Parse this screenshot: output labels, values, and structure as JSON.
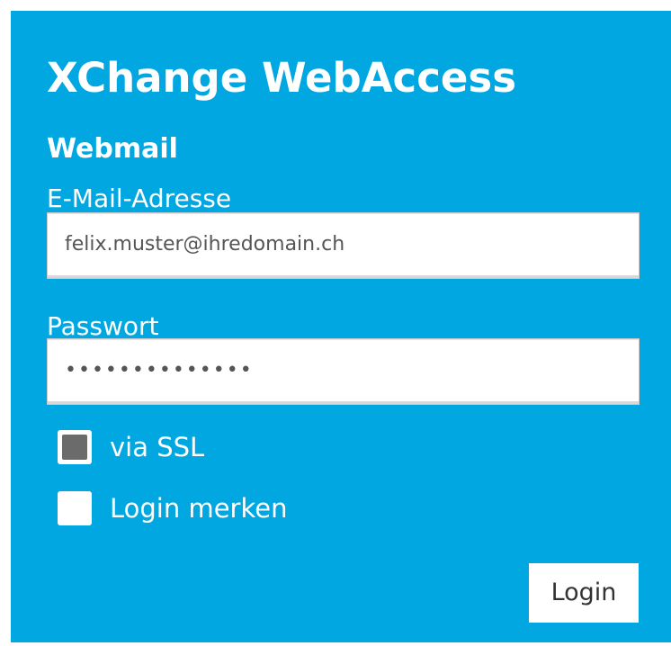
{
  "form": {
    "title": "XChange WebAccess",
    "subtitle": "Webmail",
    "email": {
      "label": "E-Mail-Adresse",
      "value": "felix.muster@ihredomain.ch"
    },
    "password": {
      "label": "Passwort",
      "masked_value": "••••••••••••••"
    },
    "options": {
      "ssl_label": "via SSL",
      "ssl_checked": true,
      "remember_label": "Login merken",
      "remember_checked": false
    },
    "login_label": "Login"
  },
  "colors": {
    "panel_background": "#00a7e1",
    "text": "#ffffff",
    "field_background": "#ffffff",
    "checkbox_mark": "#6b6b6b"
  }
}
